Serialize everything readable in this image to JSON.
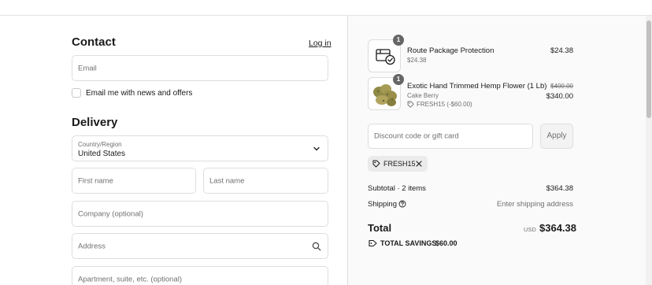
{
  "contact": {
    "title": "Contact",
    "login_label": "Log in",
    "email_placeholder": "Email",
    "newsletter_label": "Email me with news and offers"
  },
  "delivery": {
    "title": "Delivery",
    "country_label": "Country/Region",
    "country_value": "United States",
    "first_name_placeholder": "First name",
    "last_name_placeholder": "Last name",
    "company_placeholder": "Company (optional)",
    "address_placeholder": "Address",
    "apartment_placeholder": "Apartment, suite, etc. (optional)"
  },
  "cart": {
    "items": [
      {
        "quantity": "1",
        "name": "Route Package Protection",
        "sub_price": "$24.38",
        "price": "$24.38"
      },
      {
        "quantity": "1",
        "name": "Exotic Hand Trimmed Hemp Flower (1 Lb)",
        "variant": "Cake Berry",
        "discount": "FRESH15 (-$60.00)",
        "original_price": "$400.00",
        "price": "$340.00"
      }
    ]
  },
  "discount": {
    "placeholder": "Discount code or gift card",
    "apply_label": "Apply",
    "applied_code": "FRESH15"
  },
  "summary": {
    "subtotal_label": "Subtotal · 2 items",
    "subtotal_value": "$364.38",
    "shipping_label": "Shipping",
    "shipping_value": "Enter shipping address",
    "total_label": "Total",
    "currency": "USD",
    "total_value": "$364.38",
    "savings_label": "TOTAL SAVINGS",
    "savings_value": "$60.00"
  },
  "icons": {
    "chevron": "chevron-down-icon",
    "search": "search-icon",
    "package": "package-protection-icon",
    "tag": "tag-icon",
    "close": "close-icon",
    "help": "help-circle-icon"
  }
}
